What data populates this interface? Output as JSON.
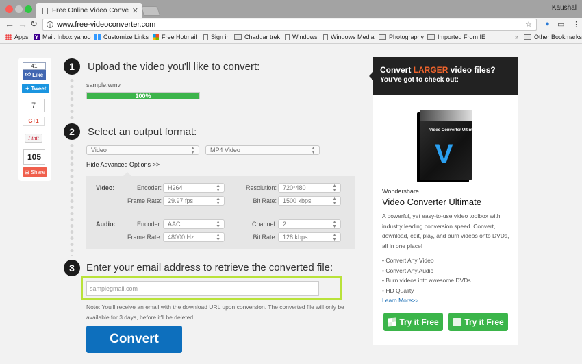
{
  "browser": {
    "tab_title": "Free Online Video Converter - O",
    "profile_name": "Kaushal",
    "url": "www.free-videoconverter.com",
    "bookmarks": [
      {
        "label": "Apps",
        "icon": "apps-icon"
      },
      {
        "label": "Mail: Inbox yahoo",
        "icon": "yahoo-icon"
      },
      {
        "label": "Customize Links",
        "icon": "windows-icon"
      },
      {
        "label": "Free Hotmail",
        "icon": "microsoft-icon"
      },
      {
        "label": "Sign in",
        "icon": "page-icon"
      },
      {
        "label": "Chaddar trek",
        "icon": "folder-icon"
      },
      {
        "label": "Windows",
        "icon": "page-icon"
      },
      {
        "label": "Windows Media",
        "icon": "page-icon"
      },
      {
        "label": "Photography",
        "icon": "folder-icon"
      },
      {
        "label": "Imported From IE",
        "icon": "folder-icon"
      }
    ],
    "overflow_label": "»",
    "other_bookmarks": "Other Bookmarks"
  },
  "social": {
    "fb_count": "41",
    "fb_like": "Like",
    "tweet": "Tweet",
    "gplus_count": "7",
    "gplus": "G+1",
    "pinit": "Pinit",
    "share_count": "105",
    "share": "Share"
  },
  "steps": {
    "step1": {
      "number": "1",
      "title": "Upload the video you'll like to convert:",
      "filename": "sample.wmv",
      "progress_percent": 100,
      "progress_label": "100%"
    },
    "step2": {
      "number": "2",
      "title": "Select an output format:",
      "category": "Video",
      "format": "MP4 Video",
      "advanced_link": "Hide Advanced Options >>",
      "video": {
        "group": "Video:",
        "encoder_label": "Encoder:",
        "encoder": "H264",
        "resolution_label": "Resolution:",
        "resolution": "720*480",
        "framerate_label": "Frame Rate:",
        "framerate": "29.97 fps",
        "bitrate_label": "Bit Rate:",
        "bitrate": "1500 kbps"
      },
      "audio": {
        "group": "Audio:",
        "encoder_label": "Encoder:",
        "encoder": "AAC",
        "channel_label": "Channel:",
        "channel": "2",
        "framerate_label": "Frame Rate:",
        "framerate": "48000 Hz",
        "bitrate_label": "Bit Rate:",
        "bitrate": "128 kbps"
      }
    },
    "step3": {
      "number": "3",
      "title": "Enter your email address to retrieve the converted file:",
      "email_placeholder": "samplegmail.com",
      "note": "Note: You'll receive an email with the download URL upon conversion. The converted file will only be available for 3 days, before it'll be deleted.",
      "convert_label": "Convert"
    }
  },
  "ad": {
    "headline_pre": "Convert ",
    "headline_accent": "LARGER",
    "headline_post": " video files?",
    "subheadline": "You've got to check out:",
    "box_title": "Video Converter Ultimate",
    "box_letter": "V",
    "brand": "Wondershare",
    "product": "Video Converter Ultimate",
    "description": "A powerful, yet easy-to-use video toolbox with industry leading conversion speed. Convert, download, edit, play, and burn videos onto DVDs, all in one place!",
    "features": [
      "• Convert Any Video",
      "• Convert Any Audio",
      "• Burn videos into awesome DVDs.",
      "• HD Quality"
    ],
    "learn_more": "Learn More>>",
    "try_windows": "Try it Free",
    "try_mac": "Try it Free",
    "accent_color": "#f0642c",
    "button_color": "#3bb54a"
  }
}
